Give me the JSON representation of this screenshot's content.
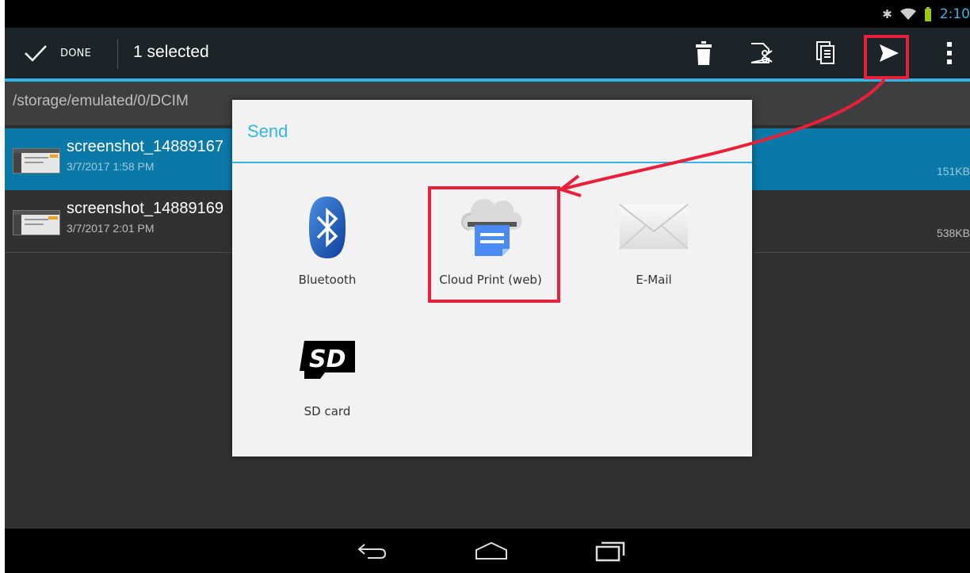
{
  "status_bar": {
    "time": "2:10"
  },
  "action_bar": {
    "done_label": "DONE",
    "title": "1 selected",
    "icons": [
      "delete-icon",
      "cut-icon",
      "copy-icon",
      "send-icon",
      "overflow-menu-icon"
    ]
  },
  "path_bar": {
    "path": "/storage/emulated/0/DCIM"
  },
  "files": [
    {
      "name": "screenshot_14889167",
      "date": "3/7/2017 1:58 PM",
      "size": "151KB",
      "selected": true
    },
    {
      "name": "screenshot_14889169",
      "date": "3/7/2017 2:01 PM",
      "size": "538KB",
      "selected": false
    }
  ],
  "dialog": {
    "title": "Send",
    "items": [
      {
        "label": "Bluetooth",
        "icon": "bluetooth-icon"
      },
      {
        "label": "Cloud Print (web)",
        "icon": "cloud-print-icon"
      },
      {
        "label": "E-Mail",
        "icon": "email-icon"
      },
      {
        "label": "SD card",
        "icon": "sd-card-icon"
      }
    ]
  },
  "colors": {
    "accent": "#33b5e5",
    "selected_row": "#0a79a8",
    "annotation": "#e8203a"
  }
}
